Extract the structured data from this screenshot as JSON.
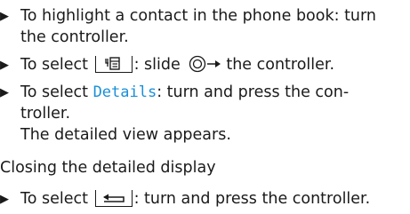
{
  "bullets": {
    "symbol": "▶",
    "item1_line1": "To highlight a contact in the phone book: turn",
    "item1_line2": "the controller.",
    "item2_pre": "To select",
    "item2_mid": ": slide",
    "item2_post": "the controller.",
    "item2_key_icon": "menu-key-icon",
    "item2_controller_icon": "controller-slide-right-icon",
    "item3_pre": "To select",
    "item3_highlight": "Details",
    "item3_post": ": turn and press the con-",
    "item3_line2": "troller.",
    "item3_result": "The detailed view appears.",
    "item4_pre": "To select",
    "item4_post": ": turn and press the controller.",
    "item4_key_icon": "back-key-icon"
  },
  "section_heading": "Closing the detailed display",
  "colors": {
    "text": "#1a1a1a",
    "highlight": "#1a8fd8"
  }
}
